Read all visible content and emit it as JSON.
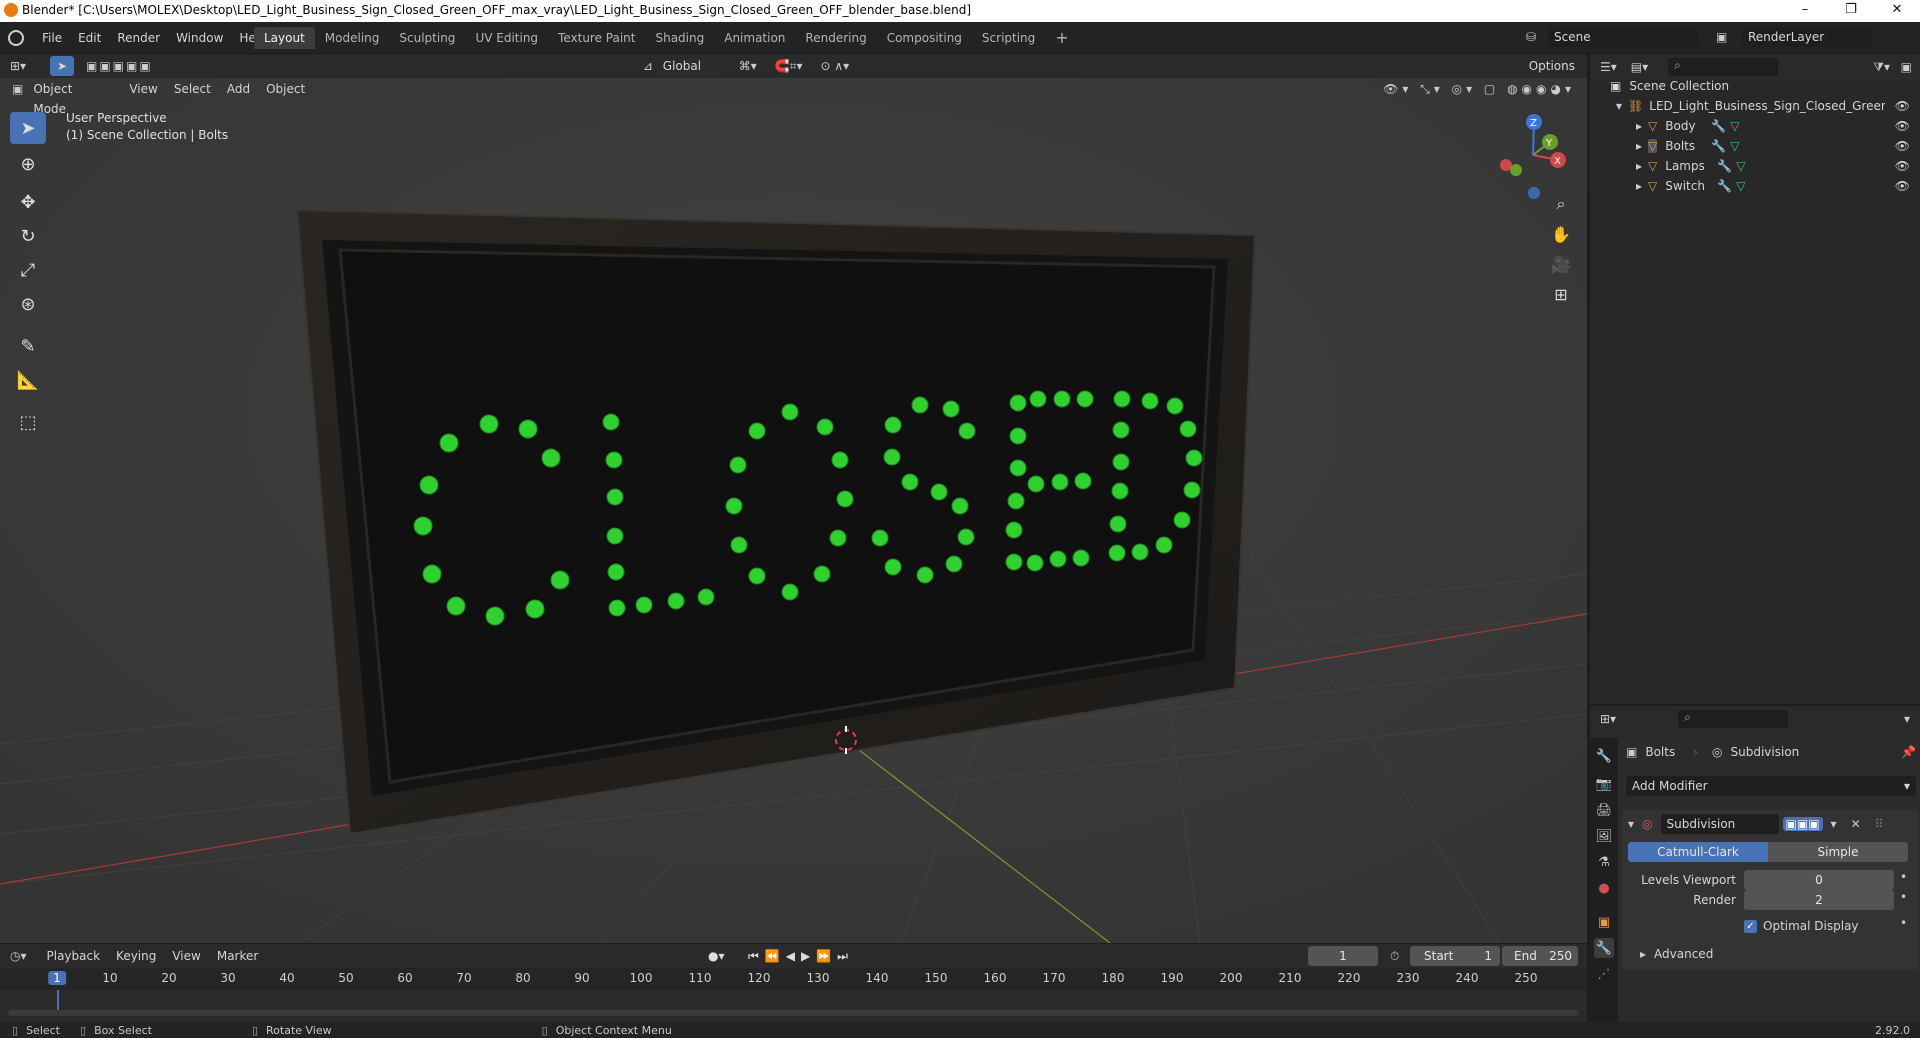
{
  "window": {
    "title": "Blender* [C:\\Users\\MOLEX\\Desktop\\LED_Light_Business_Sign_Closed_Green_OFF_max_vray\\LED_Light_Business_Sign_Closed_Green_OFF_blender_base.blend]",
    "min": "–",
    "max": "❐",
    "close": "✕"
  },
  "menu": [
    "File",
    "Edit",
    "Render",
    "Window",
    "Help"
  ],
  "workspaces": [
    "Layout",
    "Modeling",
    "Sculpting",
    "UV Editing",
    "Texture Paint",
    "Shading",
    "Animation",
    "Rendering",
    "Compositing",
    "Scripting"
  ],
  "add_tab": "+",
  "scene": {
    "label": "Scene",
    "render_layer": "RenderLayer"
  },
  "viewport_header": {
    "mode": "Object Mode",
    "items": [
      "View",
      "Select",
      "Add",
      "Object"
    ],
    "transform": "Global",
    "options": "Options"
  },
  "viewport": {
    "perspective": "User Perspective",
    "collection": "(1) Scene Collection | Bolts",
    "sign_text": "CLOSED"
  },
  "gizmo": {
    "z": "Z",
    "y": "Y",
    "x": "X"
  },
  "outliner": {
    "root": "Scene Collection",
    "collection": "LED_Light_Business_Sign_Closed_Green_OFF",
    "objects": [
      "Body",
      "Bolts",
      "Lamps",
      "Switch"
    ]
  },
  "properties": {
    "object": "Bolts",
    "modifier_name": "Subdivision",
    "add_modifier": "Add Modifier",
    "mod_panel_name": "Subdivision",
    "catmull": "Catmull-Clark",
    "simple": "Simple",
    "levels_viewport_label": "Levels Viewport",
    "levels_viewport_value": "0",
    "render_label": "Render",
    "render_value": "2",
    "optimal_display": "Optimal Display",
    "advanced": "Advanced"
  },
  "timeline": {
    "menus": [
      "Playback",
      "Keying",
      "View",
      "Marker"
    ],
    "current_frame": "1",
    "start_label": "Start",
    "start": "1",
    "end_label": "End",
    "end": "250",
    "ticks": [
      "1",
      "10",
      "20",
      "30",
      "40",
      "50",
      "60",
      "70",
      "80",
      "90",
      "100",
      "110",
      "120",
      "130",
      "140",
      "150",
      "160",
      "170",
      "180",
      "190",
      "200",
      "210",
      "220",
      "230",
      "240",
      "250"
    ]
  },
  "status": {
    "select": "Select",
    "box_select": "Box Select",
    "rotate": "Rotate View",
    "context": "Object Context Menu",
    "version": "2.92.0"
  },
  "colors": {
    "accent": "#4772b3",
    "led": "#2fd12f",
    "bg": "#3a3a3a"
  }
}
